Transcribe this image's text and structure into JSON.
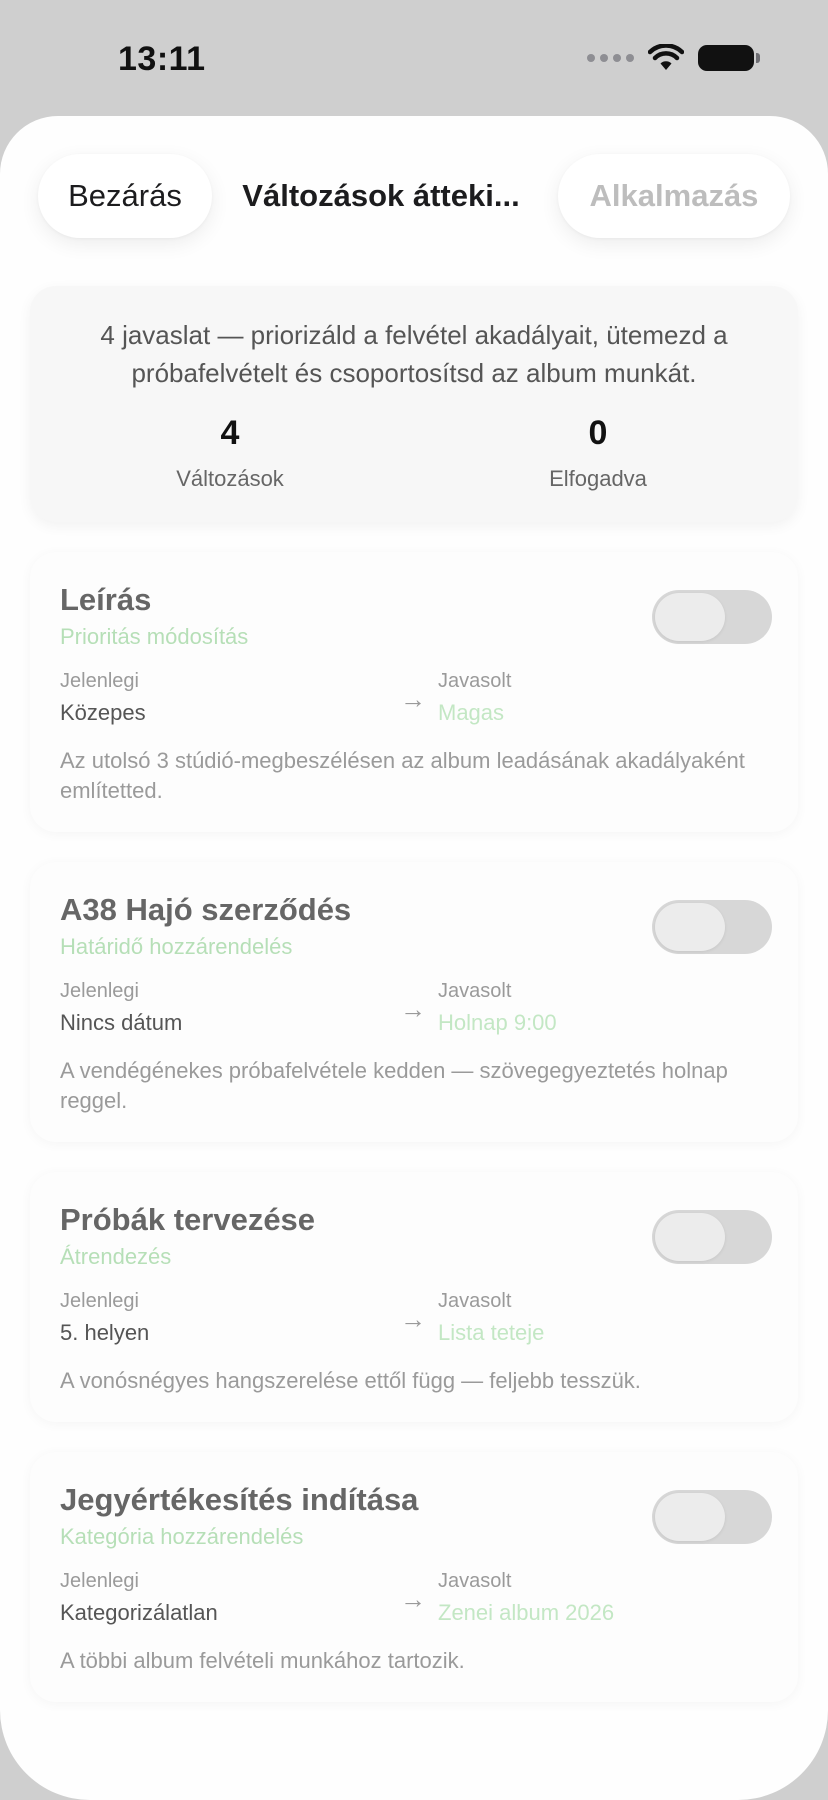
{
  "status": {
    "time": "13:11"
  },
  "nav": {
    "close_label": "Bezárás",
    "title": "Változások átteki...",
    "apply_label": "Alkalmazás"
  },
  "summary": {
    "text": "4 javaslat — priorizáld a felvétel akadályait, ütemezd a próbafelvételt és csoportosítsd az album munkát.",
    "changes_count": "4",
    "changes_label": "Változások",
    "accepted_count": "0",
    "accepted_label": "Elfogadva"
  },
  "cards": [
    {
      "title": "Leírás",
      "type": "Prioritás módosítás",
      "current_label": "Jelenlegi",
      "current_value": "Közepes",
      "suggested_label": "Javasolt",
      "suggested_value": "Magas",
      "description": "Az utolsó 3 stúdió-megbeszélésen az album leadásának akadályaként említetted.",
      "accepted": false
    },
    {
      "title": "A38 Hajó szerződés",
      "type": "Határidő hozzárendelés",
      "current_label": "Jelenlegi",
      "current_value": "Nincs dátum",
      "suggested_label": "Javasolt",
      "suggested_value": "Holnap 9:00",
      "description": "A vendégénekes próbafelvétele kedden — szövegegyeztetés holnap reggel.",
      "accepted": false
    },
    {
      "title": "Próbák tervezése",
      "type": "Átrendezés",
      "current_label": "Jelenlegi",
      "current_value": "5. helyen",
      "suggested_label": "Javasolt",
      "suggested_value": "Lista teteje",
      "description": "A vonósnégyes hangszerelése ettől függ — feljebb tesszük.",
      "accepted": false
    },
    {
      "title": "Jegyértékesítés indítása",
      "type": "Kategória hozzárendelés",
      "current_label": "Jelenlegi",
      "current_value": "Kategorizálatlan",
      "suggested_label": "Javasolt",
      "suggested_value": "Zenei album 2026",
      "description": "A többi album felvételi munkához tartozik.",
      "accepted": false
    }
  ],
  "icons": {
    "arrow": "arrow-right-icon",
    "wifi": "wifi-icon",
    "battery": "battery-icon",
    "signal": "signal-icon"
  }
}
